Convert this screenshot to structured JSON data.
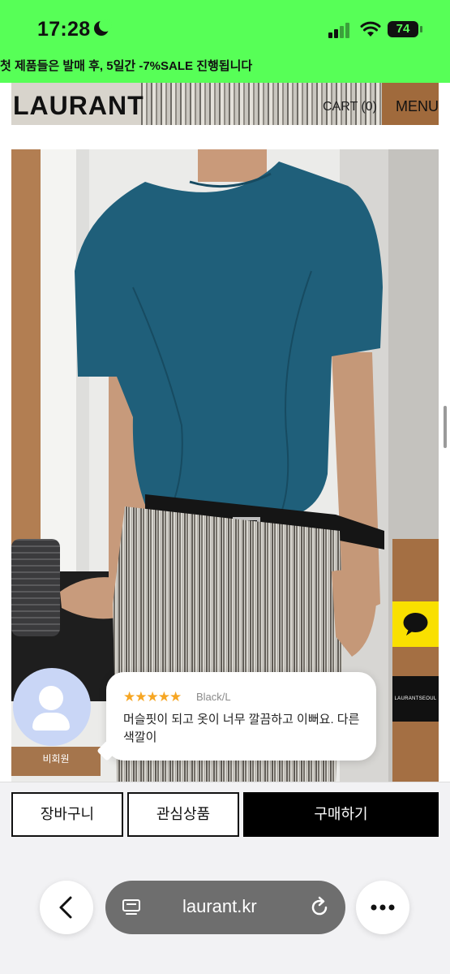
{
  "status_bar": {
    "time": "17:28",
    "battery": "74"
  },
  "announcement": "첫 제품들은 발매 후, 5일간 -7%SALE 진행됩니다",
  "site": {
    "logo": "LAURANT",
    "cart_label": "CART (0)",
    "menu_label": "MENU"
  },
  "floating": {
    "brand_badge": "LAURANTSEOUL"
  },
  "review_popup": {
    "stars": "★★★★★",
    "option": "Black/L",
    "text": "머슬핏이 되고 옷이 너무 깔끔하고 이뻐요. 다른 색깔이",
    "reviewer": "비회원"
  },
  "actions": {
    "cart": "장바구니",
    "wishlist": "관심상품",
    "buy": "구매하기"
  },
  "browser": {
    "url": "laurant.kr"
  },
  "colors": {
    "status_bar_bg": "#57ff57",
    "kakao_yellow": "#f9e000",
    "star": "#f6a623",
    "shirt": "#1f5f7a"
  },
  "icons": [
    "moon-icon",
    "signal-icon",
    "wifi-icon",
    "battery-icon",
    "chat-bubble-icon",
    "person-icon",
    "back-chevron-icon",
    "tabs-icon",
    "reload-icon",
    "more-icon"
  ]
}
